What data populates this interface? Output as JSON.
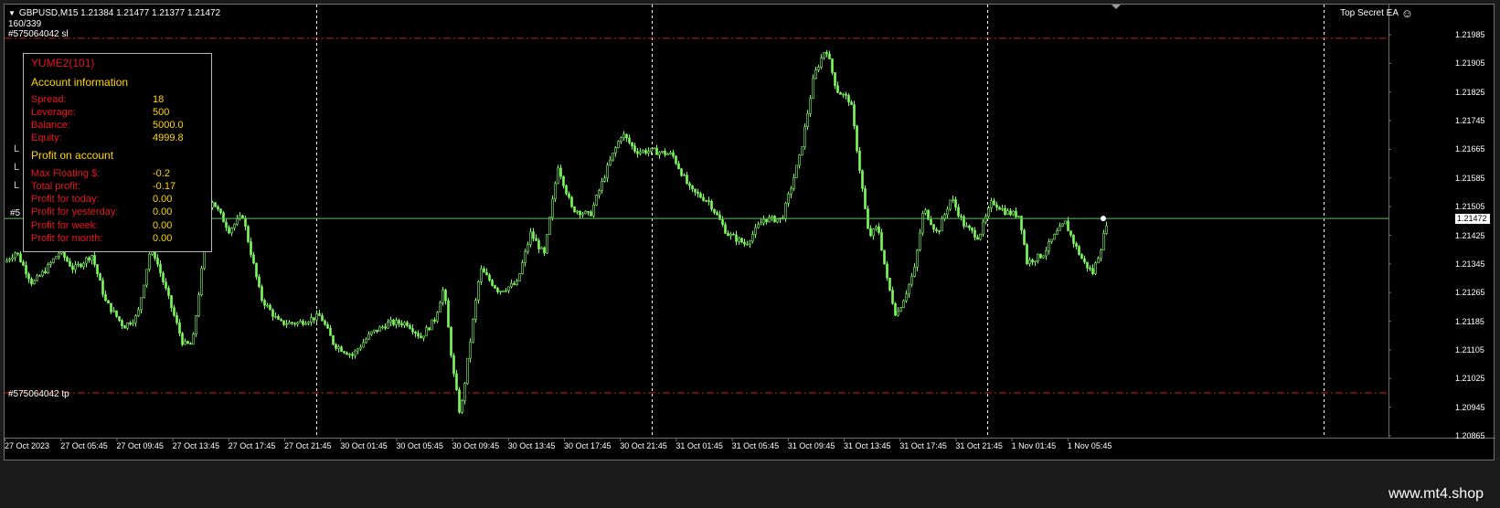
{
  "header": {
    "symbol_line": "GBPUSD,M15  1.21384 1.21477 1.21377 1.21472",
    "bars_count": "160/339",
    "sl_label": "#575064042 sl",
    "tp_label": "#575064042 tp",
    "ea_name": "Top Secret EA",
    "ea_icon": "smiley-icon",
    "partial_label": "#5"
  },
  "price_axis": {
    "labels": [
      "1.21985",
      "1.21905",
      "1.21825",
      "1.21745",
      "1.21665",
      "1.21585",
      "1.21505",
      "1.21425",
      "1.21345",
      "1.21265",
      "1.21185",
      "1.21105",
      "1.21025",
      "1.20945",
      "1.20865"
    ],
    "current": "1.21472",
    "sl_price": 1.21975,
    "tp_price": 1.20985
  },
  "time_axis": {
    "labels": [
      "27 Oct 2023",
      "27 Oct 05:45",
      "27 Oct 09:45",
      "27 Oct 13:45",
      "27 Oct 17:45",
      "27 Oct 21:45",
      "30 Oct 01:45",
      "30 Oct 05:45",
      "30 Oct 09:45",
      "30 Oct 13:45",
      "30 Oct 17:45",
      "30 Oct 21:45",
      "31 Oct 01:45",
      "31 Oct 05:45",
      "31 Oct 09:45",
      "31 Oct 13:45",
      "31 Oct 17:45",
      "31 Oct 21:45",
      "1 Nov 01:45",
      "1 Nov 05:45"
    ]
  },
  "panel": {
    "title": "YUME2(101)",
    "section1": "Account information",
    "section2": "Profit on account",
    "account": [
      {
        "label": "Spread:",
        "value": "18"
      },
      {
        "label": "Leverage:",
        "value": "500"
      },
      {
        "label": "Balance:",
        "value": "5000.0"
      },
      {
        "label": "Equity:",
        "value": "4999.8"
      }
    ],
    "profit": [
      {
        "label": "Max Floating $:",
        "value": "-0.2"
      },
      {
        "label": "Total profit:",
        "value": "-0.17"
      },
      {
        "label": "Profit for today:",
        "value": "0.00"
      },
      {
        "label": "Profit for yesterday:",
        "value": "0.00"
      },
      {
        "label": "Profit for week:",
        "value": "0.00"
      },
      {
        "label": "Profit for month:",
        "value": "0.00"
      }
    ]
  },
  "colors": {
    "candle": "#7cfc5a",
    "background": "#000000",
    "sl_tp_line": "#d01818",
    "price_line": "#5fbf5f",
    "panel_label": "#e8141e",
    "panel_value": "#ffd700"
  },
  "watermark": "www.mt4.shop"
}
